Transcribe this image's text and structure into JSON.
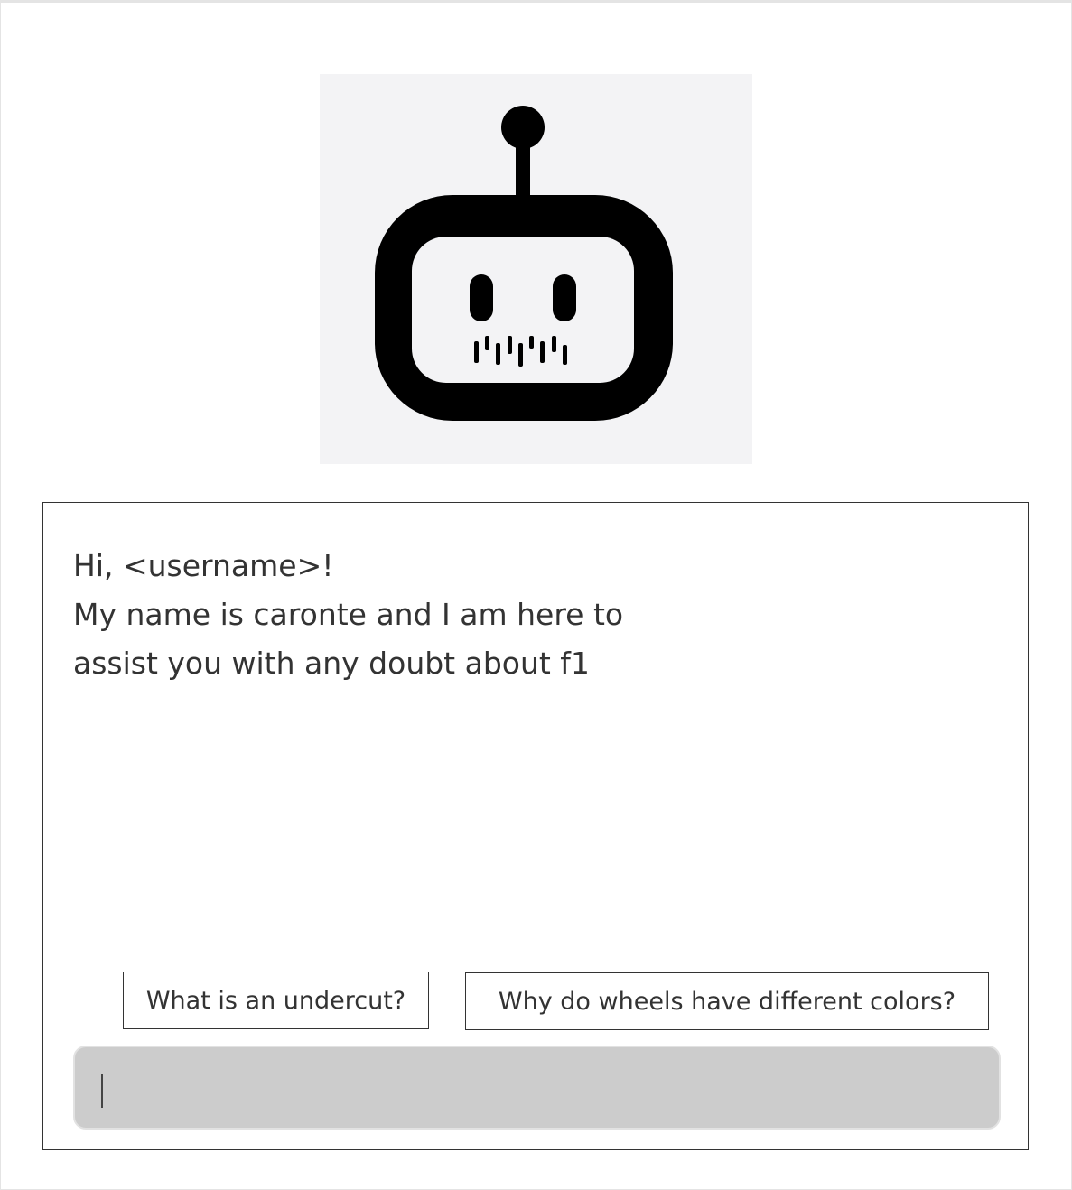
{
  "chat": {
    "greeting_lines": [
      "Hi, <username>!",
      "My name is caronte and I am here to",
      "assist you with any doubt about f1"
    ],
    "suggestions": [
      "What is an undercut?",
      "Why do wheels have different colors?"
    ],
    "input": {
      "value": "",
      "placeholder": ""
    }
  },
  "icons": {
    "avatar": "robot-head-icon"
  },
  "colors": {
    "avatar_bg": "#f3f3f5",
    "input_bg": "#cccccc",
    "text": "#333333"
  }
}
